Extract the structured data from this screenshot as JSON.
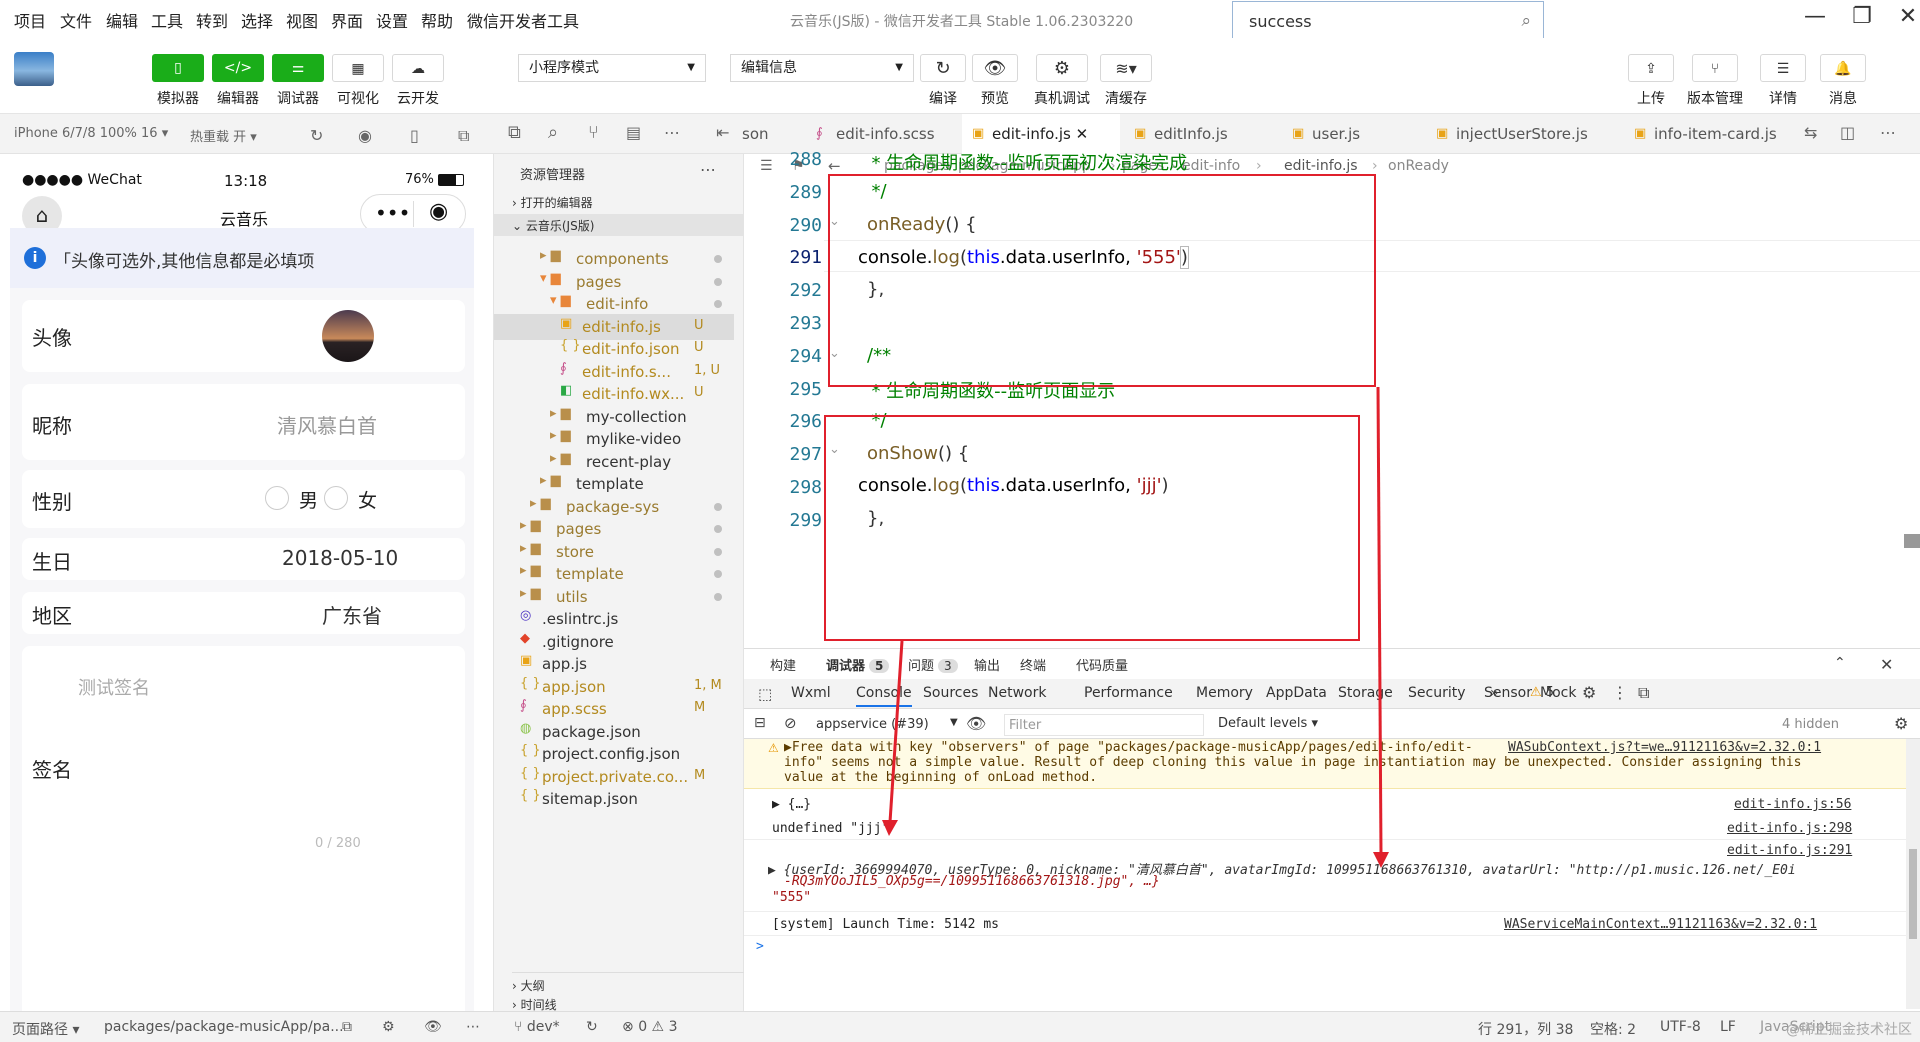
{
  "menu": [
    "项目",
    "文件",
    "编辑",
    "工具",
    "转到",
    "选择",
    "视图",
    "界面",
    "设置",
    "帮助",
    "微信开发者工具"
  ],
  "window_title": "云音乐(JS版) - 微信开发者工具 Stable 1.06.2303220",
  "search_value": "success",
  "toolbar": {
    "simulator": "模拟器",
    "editor": "编辑器",
    "debugger": "调试器",
    "visual": "可视化",
    "cloud": "云开发",
    "mode_select": "小程序模式",
    "compile_select": "编辑信息",
    "compile": "编译",
    "preview": "预览",
    "real_debug": "真机调试",
    "clear_cache": "清缓存",
    "upload": "上传",
    "version": "版本管理",
    "details": "详情",
    "messages": "消息"
  },
  "subbar": {
    "device": "iPhone 6/7/8 100% 16 ▾",
    "hot_reload": "热重载 开 ▾"
  },
  "tabs": [
    {
      "label": "son",
      "icon": ""
    },
    {
      "label": "edit-info.scss",
      "icon": "scss"
    },
    {
      "label": "edit-info.js",
      "icon": "js",
      "active": true
    },
    {
      "label": "editInfo.js",
      "icon": "js"
    },
    {
      "label": "user.js",
      "icon": "js"
    },
    {
      "label": "injectUserStore.js",
      "icon": "js"
    },
    {
      "label": "info-item-card.js",
      "icon": "js"
    }
  ],
  "breadcrumb": [
    "packages",
    "package-musicApp",
    "pages",
    "edit-info",
    "edit-info.js",
    "onReady"
  ],
  "phone": {
    "carrier": "●●●●● WeChat",
    "time": "13:18",
    "battery": "76%",
    "nav_title": "云音乐",
    "notice": "「头像可选外,其他信息都是必填项",
    "avatar_label": "头像",
    "nickname_label": "昵称",
    "nickname_value": "清风慕白首",
    "gender_label": "性别",
    "gender_male": "男",
    "gender_female": "女",
    "birthday_label": "生日",
    "birthday_value": "2018-05-10",
    "region_label": "地区",
    "region_value": "广东省",
    "signature_placeholder": "测试签名",
    "signature_label": "签名",
    "signature_count": "0 / 280"
  },
  "explorer": {
    "title": "资源管理器",
    "open_editors": "打开的编辑器",
    "project": "云音乐(JS版)",
    "items": [
      {
        "name": "components",
        "type": "folder",
        "indent": 2,
        "status": "dot"
      },
      {
        "name": "pages",
        "type": "folder-open",
        "indent": 2,
        "status": "dot"
      },
      {
        "name": "edit-info",
        "type": "folder-open",
        "indent": 3,
        "status": "dot"
      },
      {
        "name": "edit-info.js",
        "type": "js",
        "indent": 4,
        "status": "U",
        "selected": true
      },
      {
        "name": "edit-info.json",
        "type": "json",
        "indent": 4,
        "status": "U"
      },
      {
        "name": "edit-info.s...",
        "type": "scss",
        "indent": 4,
        "status": "1, U"
      },
      {
        "name": "edit-info.wx...",
        "type": "wxml",
        "indent": 4,
        "status": "U"
      },
      {
        "name": "my-collection",
        "type": "folder",
        "indent": 3,
        "status": ""
      },
      {
        "name": "mylike-video",
        "type": "folder",
        "indent": 3,
        "status": ""
      },
      {
        "name": "recent-play",
        "type": "folder",
        "indent": 3,
        "status": ""
      },
      {
        "name": "template",
        "type": "folder",
        "indent": 2,
        "status": ""
      },
      {
        "name": "package-sys",
        "type": "folder",
        "indent": 1,
        "status": "dot"
      },
      {
        "name": "pages",
        "type": "folder",
        "indent": 0,
        "status": "dot"
      },
      {
        "name": "store",
        "type": "folder",
        "indent": 0,
        "status": "dot"
      },
      {
        "name": "template",
        "type": "folder",
        "indent": 0,
        "status": "dot"
      },
      {
        "name": "utils",
        "type": "folder",
        "indent": 0,
        "status": "dot"
      },
      {
        "name": ".eslintrc.js",
        "type": "eslint",
        "indent": 0,
        "status": ""
      },
      {
        "name": ".gitignore",
        "type": "git",
        "indent": 0,
        "status": ""
      },
      {
        "name": "app.js",
        "type": "js",
        "indent": 0,
        "status": ""
      },
      {
        "name": "app.json",
        "type": "json",
        "indent": 0,
        "status": "1, M"
      },
      {
        "name": "app.scss",
        "type": "scss",
        "indent": 0,
        "status": "M"
      },
      {
        "name": "package.json",
        "type": "pkg",
        "indent": 0,
        "status": ""
      },
      {
        "name": "project.config.json",
        "type": "json",
        "indent": 0,
        "status": ""
      },
      {
        "name": "project.private.co...",
        "type": "json",
        "indent": 0,
        "status": "M"
      },
      {
        "name": "sitemap.json",
        "type": "json",
        "indent": 0,
        "status": ""
      }
    ],
    "outline": "大纲",
    "timeline": "时间线"
  },
  "code": {
    "lines": [
      "288",
      "289",
      "290",
      "291",
      "292",
      "293",
      "294",
      "295",
      "296",
      "297",
      "298",
      "299"
    ],
    "l288": "  * 生命周期函数--监听页面初次渲染完成",
    "l289": "  */",
    "l290_fn": "onReady",
    "l290_rest": "() {",
    "l291_a": "console.",
    "l291_b": "log",
    "l291_c": "(",
    "l291_d": "this",
    "l291_e": ".data.userInfo, ",
    "l291_f": "'555'",
    "l291_g": ")",
    "l292": "},",
    "l294": "/**",
    "l295": "  * 生命周期函数--监听页面显示",
    "l296": "  */",
    "l297_fn": "onShow",
    "l297_rest": "() {",
    "l298_a": "console.",
    "l298_b": "log",
    "l298_c": "(",
    "l298_d": "this",
    "l298_e": ".data.userInfo, ",
    "l298_f": "'jjj'",
    "l298_g": ")",
    "l299": "},"
  },
  "devtools": {
    "top_tabs": [
      {
        "label": "构建"
      },
      {
        "label": "调试器",
        "badge": "5",
        "active": true
      },
      {
        "label": "问题",
        "badge": "3"
      },
      {
        "label": "输出"
      },
      {
        "label": "终端"
      },
      {
        "label": "代码质量"
      }
    ],
    "panel_tabs": [
      "Wxml",
      "Console",
      "Sources",
      "Network",
      "Performance",
      "Memory",
      "AppData",
      "Storage",
      "Security",
      "Sensor",
      "Mock"
    ],
    "warn_count": "5",
    "context": "appservice (#39)",
    "filter_placeholder": "Filter",
    "levels": "Default levels ▾",
    "hidden": "4 hidden",
    "warn_text_1": "▶Free data with key \"observers\" of page \"packages/package-musicApp/pages/edit-info/edit-",
    "warn_src": "WASubContext.js?t=we…91121163&v=2.32.0:1",
    "warn_text_2": "info\" seems not a simple value. Result of deep cloning this value in page instantiation may be unexpected. Consider assigning this",
    "warn_text_3": "value at the beginning of onLoad method.",
    "log1": "▶ {…}",
    "log1_src": "edit-info.js:56",
    "log2": "undefined \"jjj\"",
    "log2_src": "edit-info.js:298",
    "log3_src": "edit-info.js:291",
    "log3_a": "▶ {userId: 3669994070, userType: 0, nickname: \"清风慕白首\", avatarImgId: 109951168663761310, avatarUrl: \"http://p1.music.126.net/_E0i",
    "log3_b": "-RQ3mYOoJIL5_OXp5g==/109951168663761318.jpg\", …}",
    "log3_c": "\"555\"",
    "log4": "[system] Launch Time: 5142 ms",
    "log4_src": "WAServiceMainContext…91121163&v=2.32.0:1",
    "prompt": ">"
  },
  "status": {
    "page_path_label": "页面路径 ▾",
    "page_path": "packages/package-musicApp/pa...",
    "branch": "dev*",
    "errors": "0",
    "warnings": "3",
    "cursor": "行 291，列 38",
    "spaces": "空格: 2",
    "encoding": "UTF-8",
    "eol": "LF",
    "lang": "JavaScript",
    "extra": "@稀土掘金技术社区"
  }
}
